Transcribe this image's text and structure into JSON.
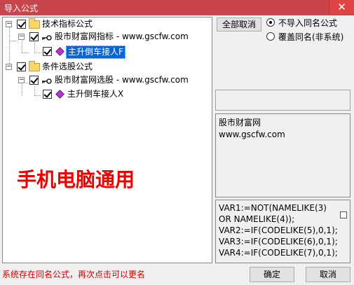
{
  "window": {
    "title": "导入公式",
    "close_glyph": "✕"
  },
  "tree": {
    "nodes": [
      {
        "label": "技术指标公式"
      },
      {
        "label": "股市财富网指标 - www.gscfw.com"
      },
      {
        "label": "主升倒车接人F"
      },
      {
        "label": "条件选股公式"
      },
      {
        "label": "股市财富网选股 - www.gscfw.com"
      },
      {
        "label": "主升倒车接人X"
      }
    ]
  },
  "watermark": "手机电脑通用",
  "options": {
    "cancel_all_label": "全部取消",
    "radio_no_import": "不导入同名公式",
    "radio_overwrite": "覆盖同名(非系统)"
  },
  "description": {
    "line1": "股市财富网",
    "line2": "www.gscfw.com"
  },
  "code": {
    "lines": [
      "VAR1:=NOT(NAMELIKE(3)",
      "OR NAMELIKE(4));",
      "VAR2:=IF(CODELIKE(5),0,1);",
      "VAR3:=IF(CODELIKE(6),0,1);",
      "VAR4:=IF(CODELIKE(7),0,1);"
    ]
  },
  "status": "系统存在同名公式，再次点击可以更名",
  "buttons": {
    "ok": "确定",
    "cancel": "取消"
  }
}
